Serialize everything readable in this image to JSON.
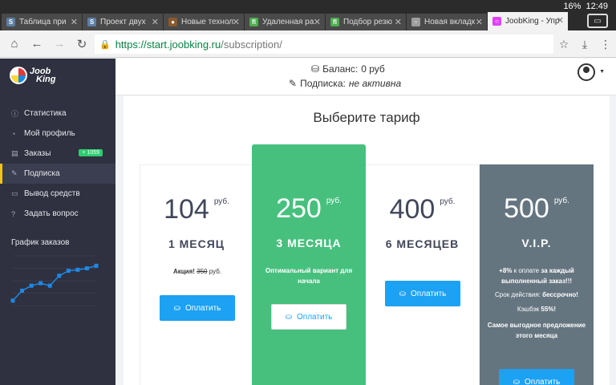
{
  "tabs": [
    {
      "label": "Таблица при",
      "color": "#5b7fa6",
      "glyph": "S"
    },
    {
      "label": "Проект двух",
      "color": "#5b7fa6",
      "glyph": "S"
    },
    {
      "label": "Новые технол",
      "color": "#8b5a2b",
      "glyph": "●"
    },
    {
      "label": "Удаленная ра",
      "color": "#4caf50",
      "glyph": "fl"
    },
    {
      "label": "Подбор резю",
      "color": "#4caf50",
      "glyph": "fl"
    },
    {
      "label": "Новая вкладк",
      "color": "#9e9e9e",
      "glyph": "▫"
    },
    {
      "label": "JoobKing - Упр",
      "color": "#e040fb",
      "glyph": "○"
    }
  ],
  "status": {
    "battery": "16%",
    "time": "12:49"
  },
  "url": {
    "host": "https://start.joobking.ru",
    "path": "/subscription/"
  },
  "logo": {
    "line1": "Joob",
    "line2": "King"
  },
  "menu": [
    {
      "label": "Статистика",
      "icon": "info-icon"
    },
    {
      "label": "Мой профиль",
      "icon": "gauge-icon"
    },
    {
      "label": "Заказы",
      "icon": "stack-icon",
      "badge": "+ 1059"
    },
    {
      "label": "Подписка",
      "icon": "pencil-icon",
      "active": true
    },
    {
      "label": "Вывод средств",
      "icon": "wallet-icon"
    },
    {
      "label": "Задать вопрос",
      "icon": "help-icon"
    }
  ],
  "chart_title": "График заказов",
  "chart_data": {
    "type": "line",
    "values": [
      10,
      30,
      40,
      45,
      40,
      60,
      70,
      72,
      75,
      80
    ],
    "ylim": [
      0,
      100
    ]
  },
  "header": {
    "balance_label": "Баланс:",
    "balance_value": "0 руб",
    "subscription_label": "Подписка:",
    "subscription_value": "не активна"
  },
  "page_title": "Выберите тариф",
  "plans": [
    {
      "price": "104",
      "currency": "руб.",
      "period": "1 МЕСЯЦ",
      "promo_label": "Акция!",
      "old_price": "350",
      "old_currency": "руб.",
      "button": "Оплатить"
    },
    {
      "price": "250",
      "currency": "руб.",
      "period": "3 МЕСЯЦА",
      "desc": "Оптимальный вариант для начала",
      "button": "Оплатить"
    },
    {
      "price": "400",
      "currency": "руб.",
      "period": "6 МЕСЯЦЕВ",
      "button": "Оплатить"
    },
    {
      "price": "500",
      "currency": "руб.",
      "period": "V.I.P.",
      "desc1a": "+8%",
      "desc1b": "к оплате",
      "desc1c": "за каждый выполненный заказ!!!",
      "desc2a": "Срок действия:",
      "desc2b": "бессрочно!",
      "desc3a": "Кэшбэк",
      "desc3b": "55%!",
      "desc4": "Самое выгодное предложение этого месяца",
      "button": "Оплатить"
    }
  ]
}
